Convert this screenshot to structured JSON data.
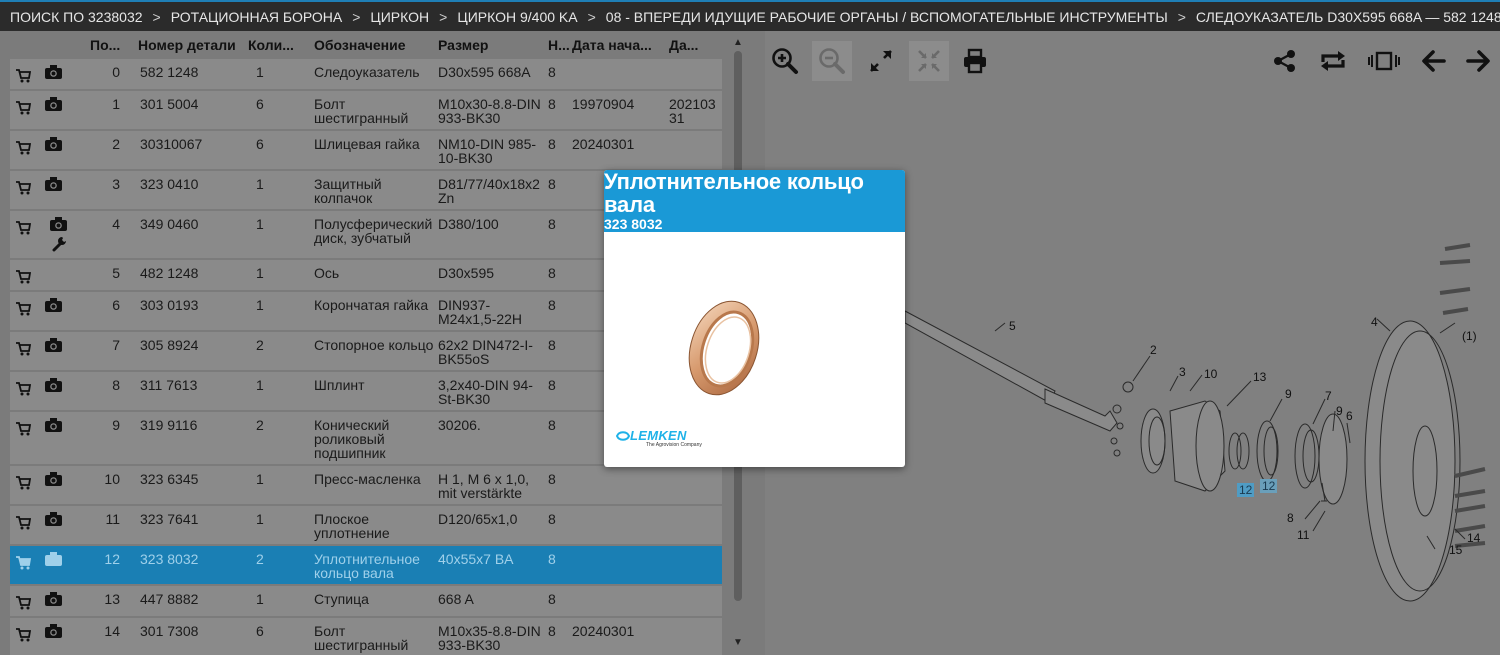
{
  "breadcrumb": [
    "ПОИСК ПО 3238032",
    "РОТАЦИОННАЯ БОРОНА",
    "ЦИРКОН",
    "ЦИРКОН 9/400 KA",
    "08 - ВПЕРЕДИ ИДУЩИЕ РАБОЧИЕ ОРГАНЫ / ВСПОМОГАТЕЛЬНЫЕ ИНСТРУМЕНТЫ",
    "СЛЕДОУКАЗАТЕЛЬ D30X595 668A — 582 1248"
  ],
  "breadcrumb_sep": ">",
  "table": {
    "headers": [
      "По...",
      "Номер детали",
      "Коли...",
      "Обозначение",
      "Размер",
      "Н...",
      "Дата нача...",
      "Да..."
    ],
    "rows": [
      {
        "pos": "0",
        "num": "582 1248",
        "qty": "1",
        "name": "Следоуказатель",
        "size": "D30x595 668A",
        "n": "8",
        "d1": "",
        "d2": "",
        "photo": true,
        "wrench": false
      },
      {
        "pos": "1",
        "num": "301 5004",
        "qty": "6",
        "name": "Болт шестигранный",
        "size": "M10x30-8.8-DIN 933-BK30",
        "n": "8",
        "d1": "19970904",
        "d2": "20210331",
        "photo": true,
        "wrench": false
      },
      {
        "pos": "2",
        "num": "30310067",
        "qty": "6",
        "name": "Шлицевая гайка",
        "size": "NM10-DIN 985-10-BK30",
        "n": "8",
        "d1": "20240301",
        "d2": "",
        "photo": true,
        "wrench": false
      },
      {
        "pos": "3",
        "num": "323 0410",
        "qty": "1",
        "name": "Защитный колпачок",
        "size": "D81/77/40x18x2 Zn",
        "n": "8",
        "d1": "",
        "d2": "",
        "photo": true,
        "wrench": false
      },
      {
        "pos": "4",
        "num": "349 0460",
        "qty": "1",
        "name": "Полусферический диск, зубчатый",
        "size": "D380/100",
        "n": "8",
        "d1": "",
        "d2": "",
        "photo": true,
        "wrench": true
      },
      {
        "pos": "5",
        "num": "482 1248",
        "qty": "1",
        "name": "Ось",
        "size": "D30x595",
        "n": "8",
        "d1": "",
        "d2": "",
        "photo": false,
        "wrench": false
      },
      {
        "pos": "6",
        "num": "303 0193",
        "qty": "1",
        "name": "Корончатая гайка",
        "size": "DIN937-M24x1,5-22H",
        "n": "8",
        "d1": "",
        "d2": "",
        "photo": true,
        "wrench": false
      },
      {
        "pos": "7",
        "num": "305 8924",
        "qty": "2",
        "name": "Стопорное кольцо",
        "size": "62x2 DIN472-I-BK55oS",
        "n": "8",
        "d1": "",
        "d2": "",
        "photo": true,
        "wrench": false
      },
      {
        "pos": "8",
        "num": "311 7613",
        "qty": "1",
        "name": "Шплинт",
        "size": "3,2x40-DIN 94-St-BK30",
        "n": "8",
        "d1": "",
        "d2": "",
        "photo": true,
        "wrench": false
      },
      {
        "pos": "9",
        "num": "319 9116",
        "qty": "2",
        "name": "Конический роликовый подшипник",
        "size": "30206.",
        "n": "8",
        "d1": "",
        "d2": "",
        "photo": true,
        "wrench": false
      },
      {
        "pos": "10",
        "num": "323 6345",
        "qty": "1",
        "name": "Пресс-масленка",
        "size": "H 1, M 6 x 1,0, mit verstärkte",
        "n": "8",
        "d1": "",
        "d2": "",
        "photo": true,
        "wrench": false
      },
      {
        "pos": "11",
        "num": "323 7641",
        "qty": "1",
        "name": "Плоское уплотнение",
        "size": "D120/65x1,0",
        "n": "8",
        "d1": "",
        "d2": "",
        "photo": true,
        "wrench": false
      },
      {
        "pos": "12",
        "num": "323 8032",
        "qty": "2",
        "name": "Уплотнительное кольцо вала",
        "size": "40x55x7 BA",
        "n": "8",
        "d1": "",
        "d2": "",
        "photo": true,
        "wrench": false,
        "selected": true
      },
      {
        "pos": "13",
        "num": "447 8882",
        "qty": "1",
        "name": "Ступица",
        "size": "668 A",
        "n": "8",
        "d1": "",
        "d2": "",
        "photo": true,
        "wrench": false
      },
      {
        "pos": "14",
        "num": "301 7308",
        "qty": "6",
        "name": "Болт шестигранный",
        "size": "M10x35-8.8-DIN 933-BK30",
        "n": "8",
        "d1": "20240301",
        "d2": "",
        "photo": true,
        "wrench": false
      }
    ]
  },
  "popup": {
    "title": "Уплотнительное кольцо вала",
    "code": "323 8032",
    "logo_text": "LEMKEN",
    "logo_sub": "The Agrovision Company"
  },
  "drawing_labels": [
    "5",
    "4",
    "2",
    "3",
    "10",
    "13",
    "9",
    "7",
    "9",
    "6",
    "(1)",
    "12",
    "12",
    "8",
    "11",
    "15",
    "14"
  ],
  "colors": {
    "header_bg": "#2b2b2b",
    "accent": "#1a99d6",
    "selected_row": "#1a7fb4",
    "logo": "#1fb2e8"
  },
  "icons": {
    "toolbar_left": [
      "zoom-in-icon",
      "zoom-out-icon",
      "expand-icon",
      "fit-icon",
      "print-icon"
    ],
    "toolbar_right": [
      "share-icon",
      "rotate-icon",
      "carousel-icon",
      "arrow-left-icon",
      "arrow-right-icon"
    ]
  }
}
